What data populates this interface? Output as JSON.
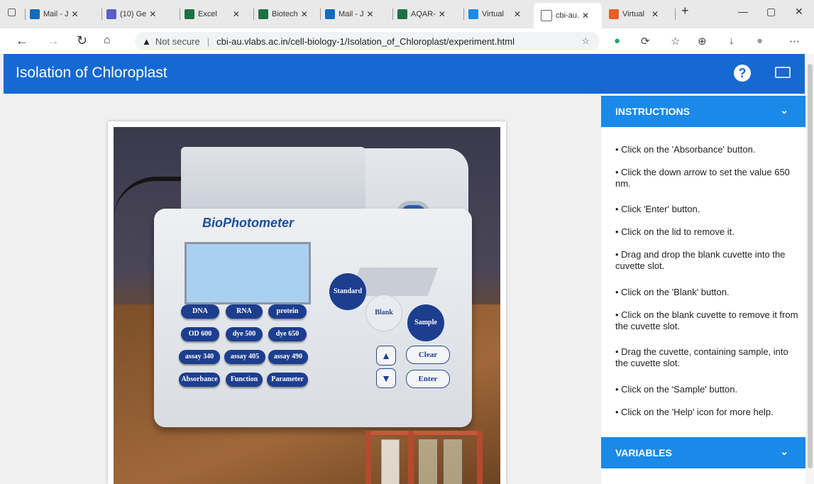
{
  "browser": {
    "tabs": [
      {
        "label": "Mail - J",
        "color": "#0f6cbd"
      },
      {
        "label": "(10) Ge",
        "color": "#5b5fc7"
      },
      {
        "label": "Excel",
        "color": "#1e7145"
      },
      {
        "label": "Biotech",
        "color": "#1e7145"
      },
      {
        "label": "Mail - J",
        "color": "#0f6cbd"
      },
      {
        "label": "AQAR-",
        "color": "#1e7145"
      },
      {
        "label": "Virtual",
        "color": "#1a89e8"
      },
      {
        "label": "cbi-au.",
        "color": "#666666"
      },
      {
        "label": "Virtual",
        "color": "#e85d2a"
      }
    ],
    "security": "Not secure",
    "url": "cbi-au.vlabs.ac.in/cell-biology-1/Isolation_of_Chloroplast/experiment.html"
  },
  "app": {
    "title": "Isolation of Chloroplast",
    "help_label": "?"
  },
  "device": {
    "brand": "BioPhotometer",
    "keys": [
      [
        "DNA",
        "RNA",
        "protein"
      ],
      [
        "OD 600",
        "dye 500",
        "dye 650"
      ],
      [
        "assay 340",
        "assay 405",
        "assay 490"
      ],
      [
        "Absorbance",
        "Function",
        "Parameter"
      ]
    ],
    "standard": "Standard",
    "blank": "Blank",
    "sample": "Sample",
    "up": "▲",
    "down": "▼",
    "clear": "Clear",
    "enter": "Enter"
  },
  "panel": {
    "instructions_header": "INSTRUCTIONS",
    "variables_header": "VARIABLES",
    "instructions": [
      "• Click on the 'Absorbance' button.",
      "• Click the down arrow to set the value 650 nm.",
      "• Click 'Enter' button.",
      "• Click on the lid to remove it.",
      "• Drag and drop the blank cuvette into the cuvette slot.",
      "• Click on the 'Blank' button.",
      "• Click on the blank cuvette to remove it from the cuvette slot.",
      "• Drag the cuvette, containing sample, into the cuvette slot.",
      "• Click on the 'Sample' button.",
      "• Click on the 'Help' icon for more help."
    ]
  }
}
